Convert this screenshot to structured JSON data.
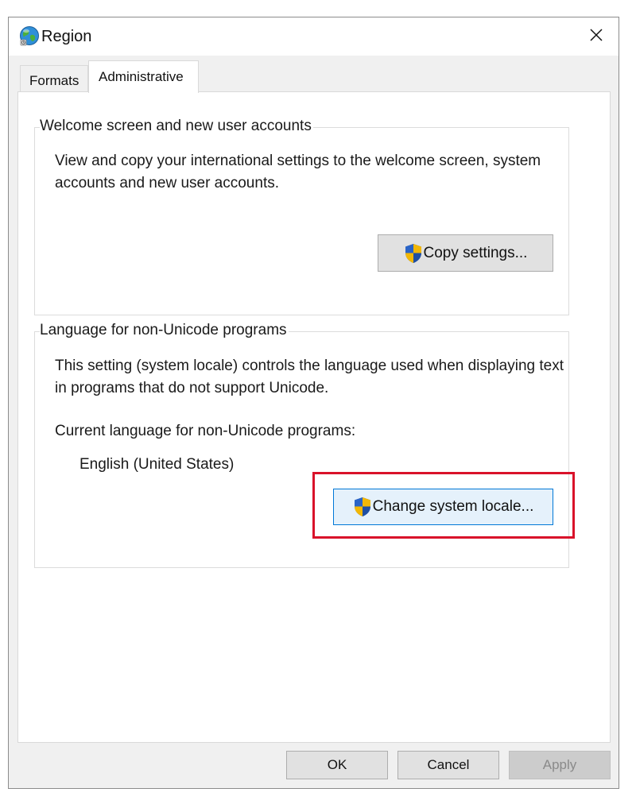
{
  "window": {
    "title": "Region",
    "icon": "globe-icon",
    "close_icon": "close-icon"
  },
  "tabs": [
    {
      "label": "Formats",
      "selected": false
    },
    {
      "label": "Administrative",
      "selected": true
    }
  ],
  "welcome_group": {
    "legend": "Welcome screen and new user accounts",
    "description": "View and copy your international settings to the welcome screen, system accounts and new user accounts.",
    "button_label": "Copy settings...",
    "button_icon": "uac-shield-icon"
  },
  "language_group": {
    "legend": "Language for non-Unicode programs",
    "description": "This setting (system locale) controls the language used when displaying text in programs that do not support Unicode.",
    "current_label": "Current language for non-Unicode programs:",
    "current_value": "English (United States)",
    "button_label": "Change system locale...",
    "button_icon": "uac-shield-icon",
    "button_highlighted": true
  },
  "footer": {
    "ok_label": "OK",
    "cancel_label": "Cancel",
    "apply_label": "Apply",
    "apply_enabled": false
  },
  "colors": {
    "highlight_border": "#d9122a",
    "focus_border": "#0078d7",
    "dialog_background": "#f0f0f0"
  }
}
